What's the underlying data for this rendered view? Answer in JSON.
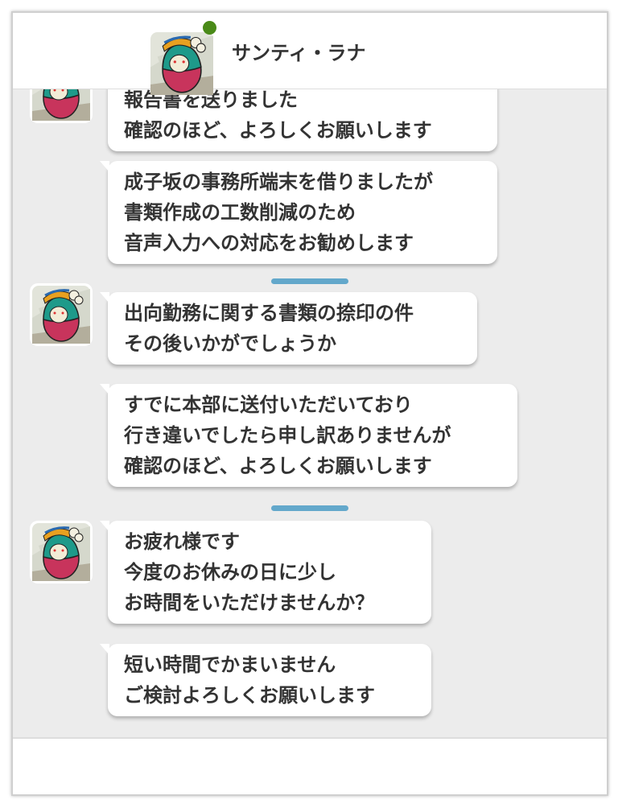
{
  "header": {
    "contact_name": "サンティ・ラナ",
    "status": "online",
    "status_color": "#4a8a18"
  },
  "messages": [
    {
      "text": "報告書を送りました\n確認のほど、よろしくお願いします"
    },
    {
      "text": "成子坂の事務所端末を借りましたが\n書類作成の工数削減のため\n音声入力への対応をお勧めします"
    },
    {
      "text": "出向勤務に関する書類の捺印の件\nその後いかがでしょうか"
    },
    {
      "text": "すでに本部に送付いただいており\n行き違いでしたら申し訳ありませんが\n確認のほど、よろしくお願いします"
    },
    {
      "text": "お疲れ様です\n今度のお休みの日に少し\nお時間をいただけませんか？"
    },
    {
      "text": "短い時間でかまいません\nご検討よろしくお願いします"
    }
  ],
  "colors": {
    "divider": "#63a8cb",
    "background": "#ececec"
  }
}
